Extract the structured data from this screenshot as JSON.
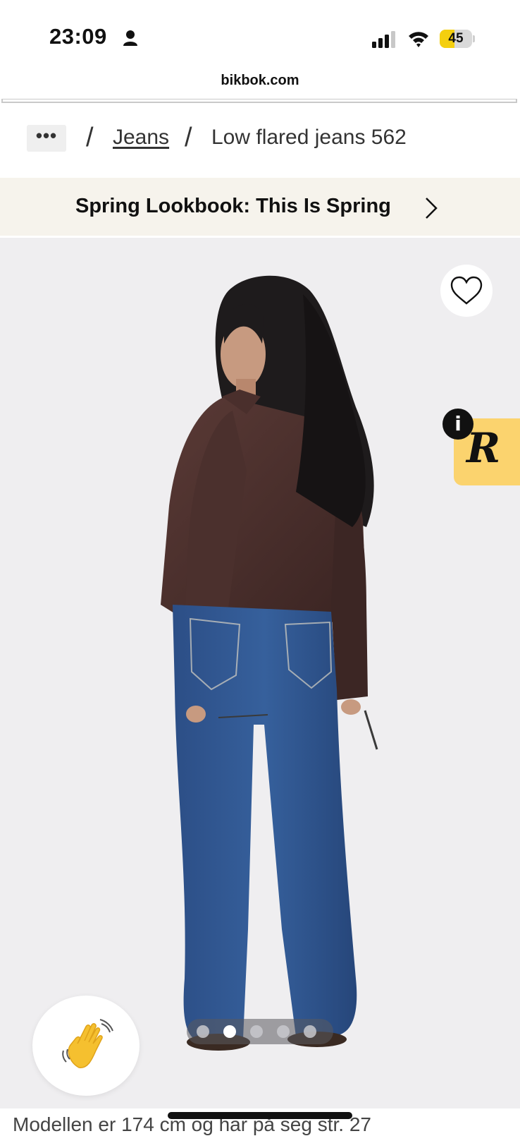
{
  "status_bar": {
    "time": "23:09",
    "battery_level": "45",
    "battery_fraction": 0.45,
    "battery_color": "#f4cf0f",
    "icons": [
      "person-icon",
      "signal-icon",
      "wifi-icon",
      "battery-icon"
    ]
  },
  "browser": {
    "url": "bikbok.com"
  },
  "breadcrumb": {
    "more": "•••",
    "separator": "/",
    "category": "Jeans",
    "current": "Low flared jeans 562"
  },
  "promo": {
    "text": "Spring Lookbook: This Is Spring",
    "icon": "chevron-right-icon",
    "background": "#f6f3ec"
  },
  "product": {
    "wishlist_icon": "heart-icon",
    "widget_letter": "R",
    "widget_color": "#fbd36e",
    "info_label": "i",
    "chat_icon": "waving-hand-icon",
    "carousel": {
      "count": 5,
      "active_index": 1
    },
    "caption": "Modellen er 174 cm og har på seg str. 27"
  }
}
